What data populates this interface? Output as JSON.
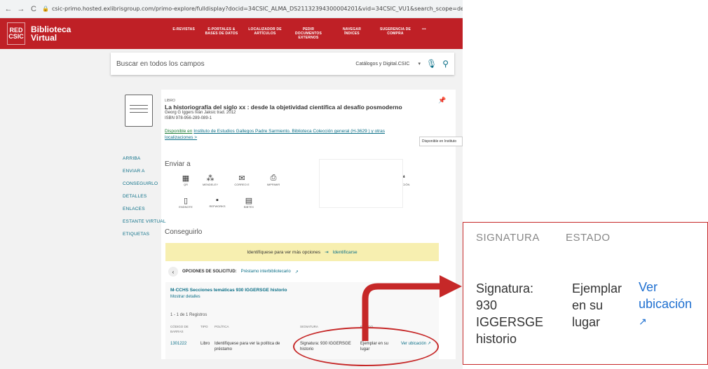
{
  "browser": {
    "back": "←",
    "forward": "→",
    "reload": "C",
    "url": "csic-primo.hosted.exlibrisgroup.com/primo-explore/fulldisplay?docid=34CSIC_ALMA_DS21132394300004201&vid=34CSIC_VU1&search_scope=default_scope&tab=de"
  },
  "header": {
    "logo": [
      "RED",
      "CSIC"
    ],
    "brand_line1": "Biblioteca",
    "brand_line2": "Virtual",
    "menu": [
      "E-REVISTAS",
      "E-PORTALES & BASES DE DATOS",
      "LOCALIZADOR DE ARTÍCULOS",
      "PEDIR DOCUMENTOS EXTERNOS",
      "NAVEGAR ÍNDICES",
      "SUGERENCIA DE COMPRA",
      "•••"
    ]
  },
  "search": {
    "placeholder": "Buscar en todos los campos",
    "scope": "Catálogos y Digital.CSIC"
  },
  "sidebar": [
    "ARRIBA",
    "ENVIAR A",
    "CONSEGUIRLO",
    "DETALLES",
    "ENLACES",
    "ESTANTE VIRTUAL",
    "ETIQUETAS"
  ],
  "record": {
    "type": "LIBRO",
    "title": "La historiografía del siglo xx : desde la objetividad científica al desafío posmoderno",
    "authors": "Georg G Iggers Iván Jaksic trad. 2012",
    "isbn": "ISBN 978-956-289-089-1",
    "avail_prefix": "Disponible en",
    "avail_text": "Instituto de Estudios Gallegos Padre Sarmiento. Biblioteca  Colección general (H-3629 ) y otras",
    "avail_link": "localizaciones  >",
    "tooltip": "Disponible en Instituto"
  },
  "send": {
    "heading": "Enviar a",
    "items": [
      "QR",
      "MENDELEY",
      "CORREO E",
      "IMPRIMIR",
      "ENDNOTE",
      "REFWORKS",
      "BIBTEX",
      "CITACIÓN"
    ]
  },
  "get": {
    "heading": "Conseguirlo",
    "login_msg": "Identifíquese para ver más opciones",
    "login_link": "Identificarse",
    "options_label": "OPCIONES DE SOLICITUD:",
    "options_link": "Préstamo interbibliotecario",
    "loc_title": "M-CCHS  Secciones temáticas  930 IGGERSGE historio",
    "loc_details": "Mostrar detalles",
    "count": "1 - 1 de 1 Registros",
    "cols": [
      "CÓDIGO DE BARRAS",
      "TIPO",
      "POLÍTICA",
      "SIGNATURA",
      "ESTADO"
    ],
    "row": {
      "barcode": "1301222",
      "type": "Libro",
      "policy": "Identifíquese para ver la política de préstamo",
      "sig": "Signatura: 930 IGGERSGE historio",
      "state": "Ejemplar en su lugar",
      "loc_link": "Ver ubicación"
    }
  },
  "zoom": {
    "col1": "SIGNATURA",
    "col2": "ESTADO",
    "sig": "Signatura: 930 IGGERSGE historio",
    "state": "Ejemplar en su lugar",
    "link": "Ver ubicación"
  },
  "colors": {
    "brand": "#bf2026",
    "link": "#0b6f87",
    "annotation": "#c62828",
    "notice": "#f7efb0"
  }
}
